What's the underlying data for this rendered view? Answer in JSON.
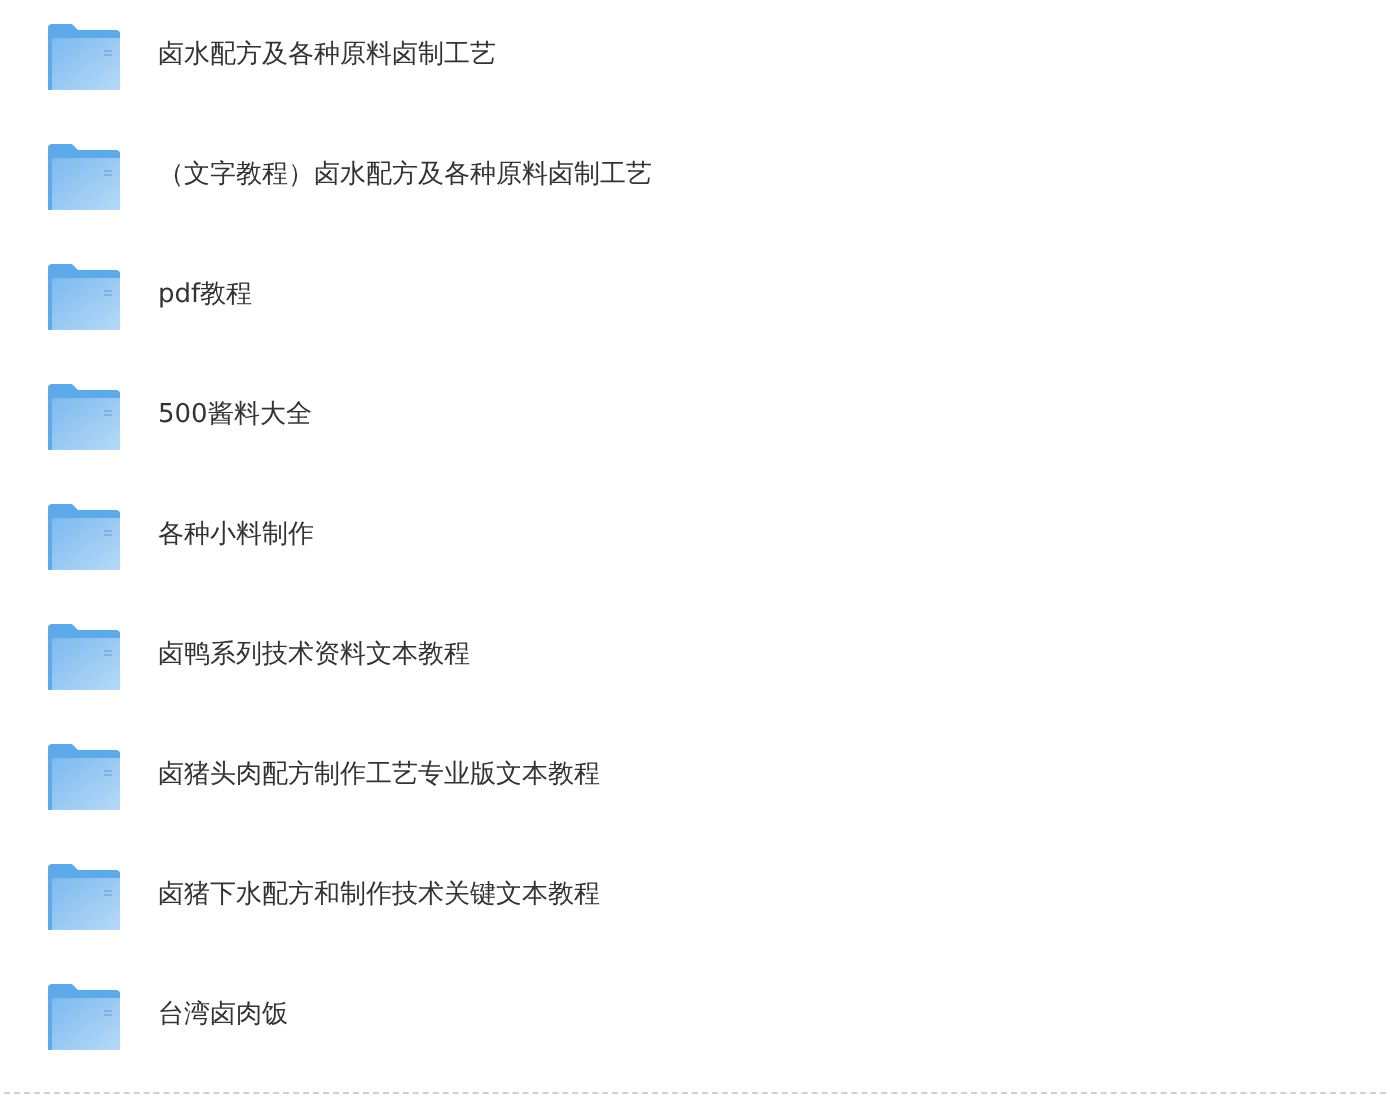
{
  "folders": [
    {
      "name": "卤水配方及各种原料卤制工艺"
    },
    {
      "name": "（文字教程）卤水配方及各种原料卤制工艺"
    },
    {
      "name": "pdf教程"
    },
    {
      "name": "500酱料大全"
    },
    {
      "name": "各种小料制作"
    },
    {
      "name": "卤鸭系列技术资料文本教程"
    },
    {
      "name": "卤猪头肉配方制作工艺专业版文本教程"
    },
    {
      "name": "卤猪下水配方和制作技术关键文本教程"
    },
    {
      "name": "台湾卤肉饭"
    }
  ]
}
